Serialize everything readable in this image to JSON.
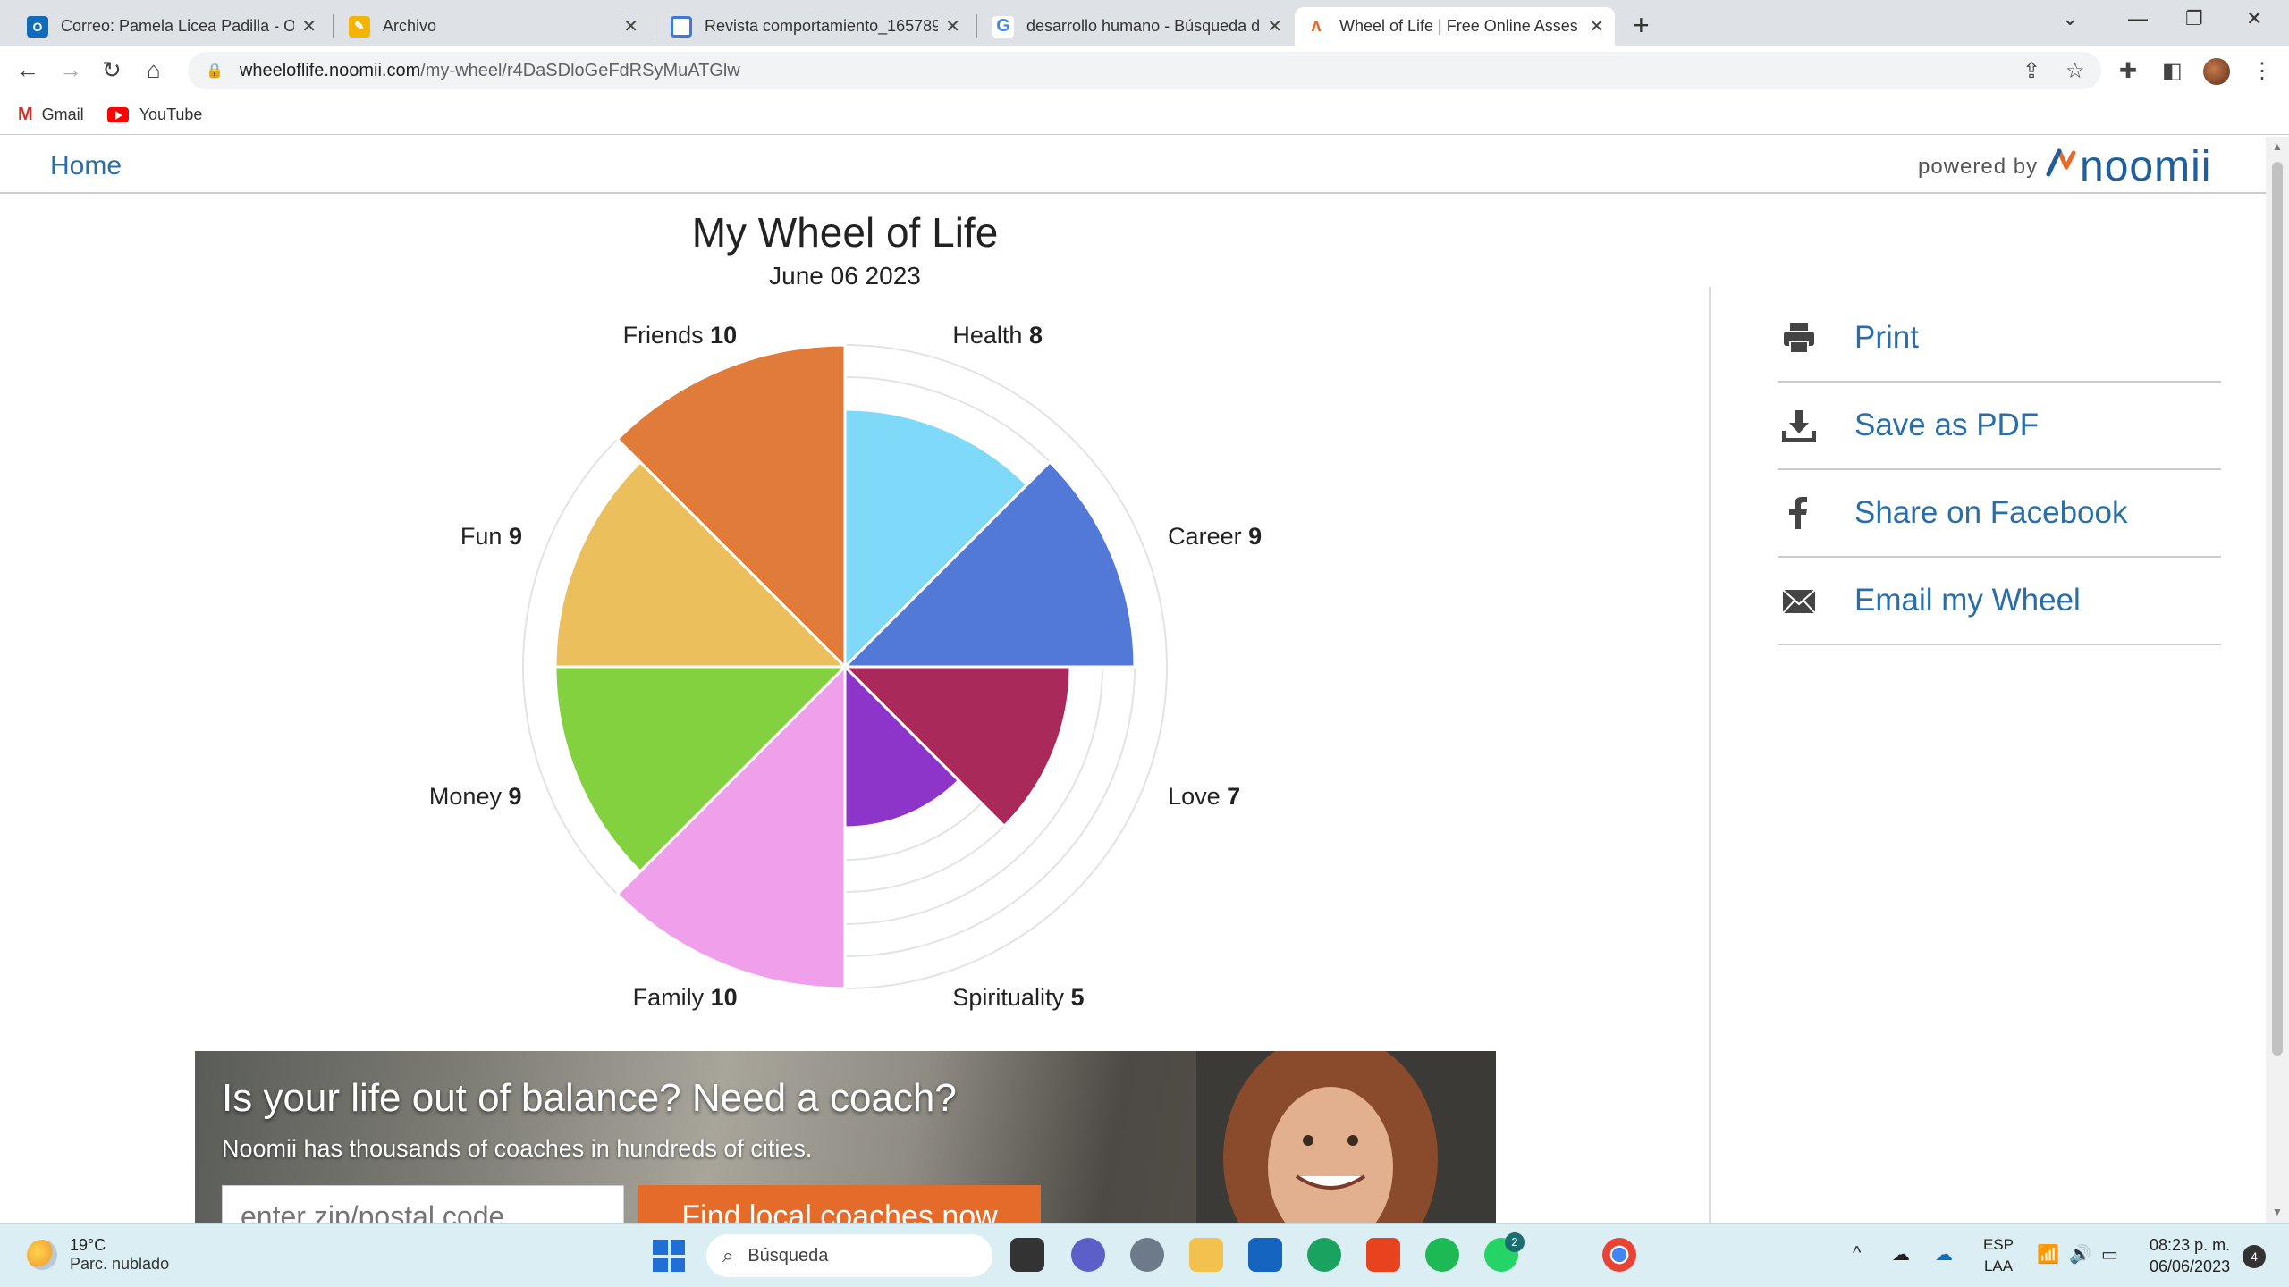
{
  "browser": {
    "tabs": [
      {
        "title": "Correo: Pamela Licea Padilla - Ou",
        "icon": "outlook-icon"
      },
      {
        "title": "Archivo",
        "icon": "pencil-icon"
      },
      {
        "title": "Revista comportamiento_165789",
        "icon": "loading-icon"
      },
      {
        "title": "desarrollo humano - Búsqueda d",
        "icon": "google-icon"
      },
      {
        "title": "Wheel of Life | Free Online Asses",
        "icon": "noomii-icon"
      }
    ],
    "url_host": "wheeloflife.noomii.com",
    "url_path": "/my-wheel/r4DaSDloGeFdRSyMuATGlw",
    "bookmarks": [
      {
        "label": "Gmail",
        "icon": "gmail-icon"
      },
      {
        "label": "YouTube",
        "icon": "youtube-icon"
      }
    ]
  },
  "site": {
    "home_label": "Home",
    "powered_by": "powered by",
    "brand": "noomii"
  },
  "wheel": {
    "title": "My Wheel of Life",
    "date": "June 06 2023"
  },
  "chart_data": {
    "type": "polar-area",
    "max": 10,
    "rings": 10,
    "segments": [
      {
        "name": "Health",
        "value": 8,
        "color": "#7fd9f8"
      },
      {
        "name": "Career",
        "value": 9,
        "color": "#5278d8"
      },
      {
        "name": "Love",
        "value": 7,
        "color": "#a8295a"
      },
      {
        "name": "Spirituality",
        "value": 5,
        "color": "#8c35c8"
      },
      {
        "name": "Family",
        "value": 10,
        "color": "#f0a0ea"
      },
      {
        "name": "Money",
        "value": 9,
        "color": "#84d140"
      },
      {
        "name": "Fun",
        "value": 9,
        "color": "#ebbf5c"
      },
      {
        "name": "Friends",
        "value": 10,
        "color": "#e07b3a"
      }
    ]
  },
  "actions": [
    {
      "label": "Print",
      "icon": "printer-icon"
    },
    {
      "label": "Save as PDF",
      "icon": "download-icon"
    },
    {
      "label": "Share on Facebook",
      "icon": "facebook-icon"
    },
    {
      "label": "Email my Wheel",
      "icon": "envelope-icon"
    }
  ],
  "banner": {
    "heading": "Is your life out of balance? Need a coach?",
    "subheading": "Noomii has thousands of coaches in hundreds of cities.",
    "zip_placeholder": "enter zip/postal code",
    "button": "Find local coaches now"
  },
  "taskbar": {
    "temperature": "19°C",
    "weather": "Parc. nublado",
    "search": "Búsqueda",
    "lang1": "ESP",
    "lang2": "LAA",
    "time": "08:23 p. m.",
    "date": "06/06/2023",
    "notifications": "4",
    "whatsapp_badge": "2"
  }
}
